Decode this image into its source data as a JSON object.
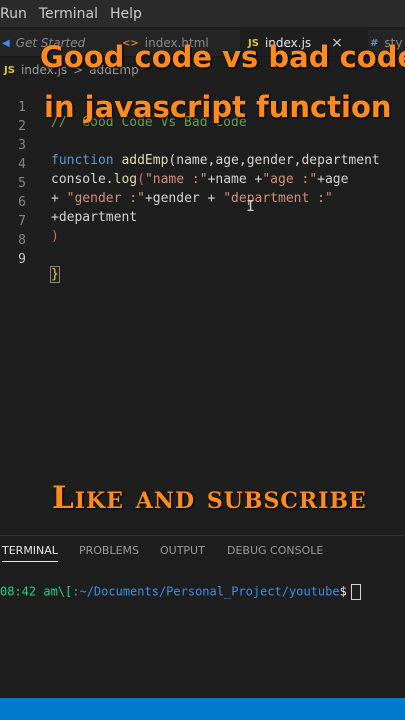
{
  "menubar": {
    "items": [
      "Run",
      "Terminal",
      "Help"
    ]
  },
  "tabs": [
    {
      "label": "Get Started",
      "icon": "vscode-icon"
    },
    {
      "label": "index.html",
      "icon": "<>"
    },
    {
      "label": "index.js",
      "icon": "JS",
      "close": "×"
    },
    {
      "label": "sty",
      "icon": "#"
    }
  ],
  "breadcrumb": {
    "badge": "JS",
    "file": "index.js",
    "sep": ">",
    "symbol": "addEmp"
  },
  "editor": {
    "line_numbers": [
      "1",
      "2",
      "3",
      "4",
      "5",
      "6",
      "7",
      "8",
      "9"
    ],
    "line1": "//  Good Code Vs Bad Code",
    "line3_kw": "function",
    "line3_fn": "addEmp",
    "line3_args": "(name,age,gender,department",
    "line4_a": "console.",
    "line4_fn": "log",
    "line4_p": "(",
    "line4_s1": "\"name :\"",
    "line4_b": "+name +",
    "line4_s2": "\"age :\"",
    "line4_c": "+age",
    "line5_a": "+ ",
    "line5_s1": "\"gender :\"",
    "line5_b": "+gender + ",
    "line5_s2": "\"department :\"",
    "line6": "+department",
    "line7": ")",
    "line9": "}"
  },
  "overlay": {
    "title_line1": "Good code vs bad code",
    "title_line2": "in javascript function",
    "subscribe": "Like and subscribe"
  },
  "panel": {
    "tabs": [
      "TERMINAL",
      "PROBLEMS",
      "OUTPUT",
      "DEBUG CONSOLE"
    ],
    "active": "TERMINAL"
  },
  "terminal": {
    "time": "08:42 am\\[",
    "path": ":~/Documents/Personal_Project/youtube",
    "prompt": "$"
  },
  "colors": {
    "accent": "#ff8a1f",
    "statusbar": "#007acc"
  }
}
